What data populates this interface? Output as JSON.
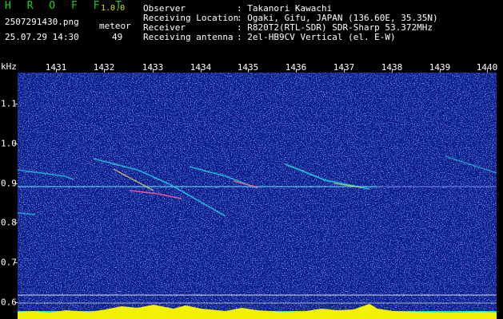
{
  "app": {
    "title": "H R O F F T",
    "version": "1.0.0",
    "file_name": "2507291430.png",
    "timestamp": "25.07.29 14:30",
    "meteor_label": "meteor",
    "meteor_count": "49"
  },
  "info": [
    {
      "label": "Observer",
      "value": ": Takanori Kawachi"
    },
    {
      "label": "Receiving Location",
      "value": ": Ogaki, Gifu, JAPAN (136.60E, 35.35N)"
    },
    {
      "label": "Receiver",
      "value": ": R820T2(RTL-SDR) SDR-Sharp 53.372MHz"
    },
    {
      "label": "Receiving antenna",
      "value": ": 2el-HB9CV Vertical (el. E-W)"
    }
  ],
  "axis": {
    "y_unit": "kHz",
    "x_ticks": [
      "1431",
      "1432",
      "1433",
      "1434",
      "1435",
      "1436",
      "1437",
      "1438",
      "1439",
      "1440"
    ],
    "y_ticks": [
      "1.1",
      "1.0",
      "0.9",
      "0.8",
      "0.7",
      "0.6"
    ]
  },
  "colors": {
    "background": "#0a1a8c",
    "signal": "#1fd6e0",
    "noise_floor": "#20e0f0",
    "noise_peak": "#f0f000"
  }
}
